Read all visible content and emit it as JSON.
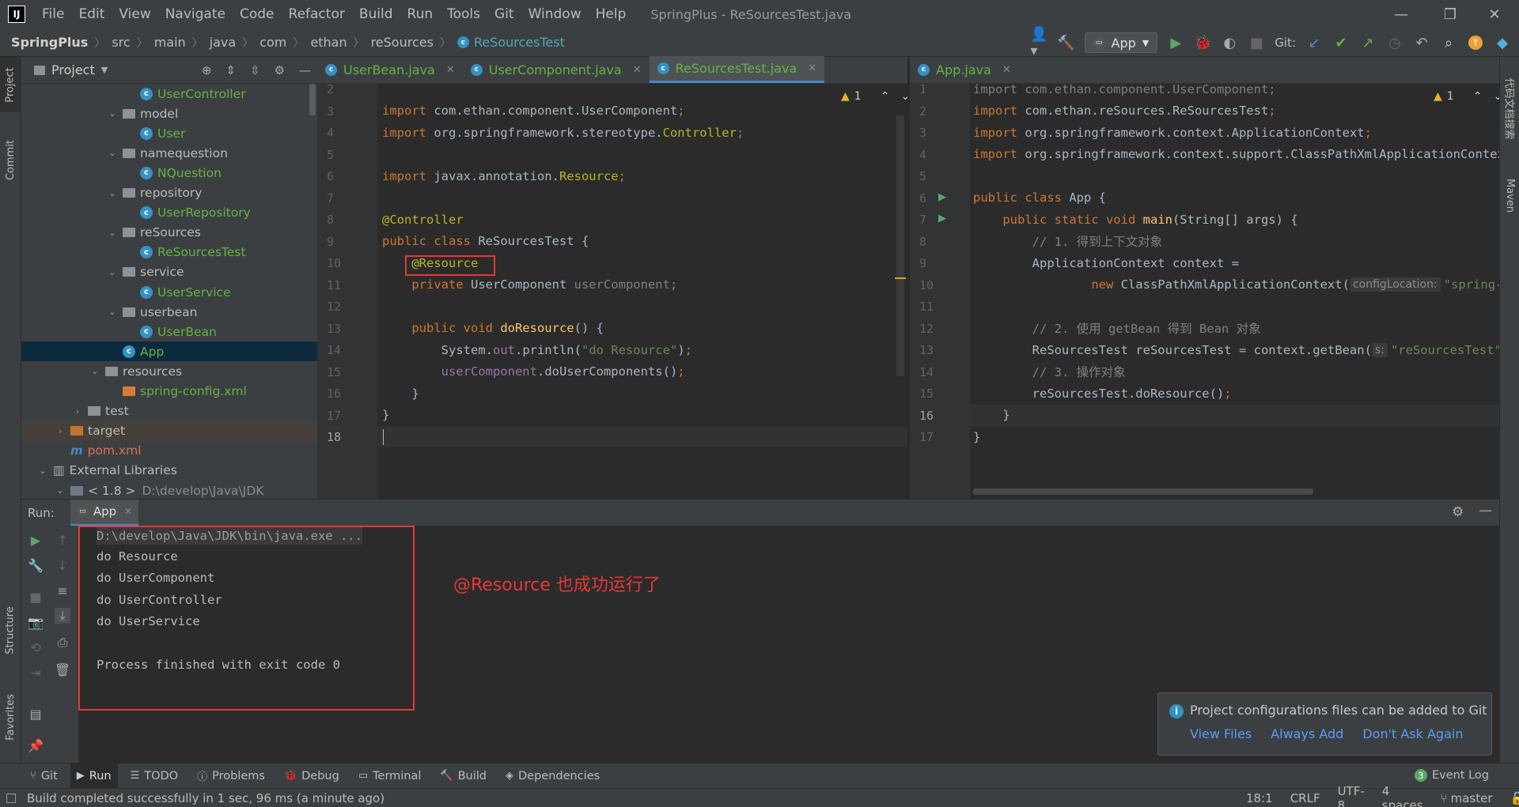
{
  "app": {
    "logo_text": "IJ",
    "menu": [
      "File",
      "Edit",
      "View",
      "Navigate",
      "Code",
      "Refactor",
      "Build",
      "Run",
      "Tools",
      "Git",
      "Window",
      "Help"
    ],
    "window_title": "SpringPlus - ReSourcesTest.java"
  },
  "breadcrumb": [
    "SpringPlus",
    "src",
    "main",
    "java",
    "com",
    "ethan",
    "reSources",
    "ReSourcesTest"
  ],
  "toolbar": {
    "run_config": "App",
    "git_label": "Git:"
  },
  "project_panel": {
    "title": "Project",
    "tree": [
      {
        "label": "UserController",
        "kind": "class",
        "indent": 5
      },
      {
        "label": "model",
        "kind": "folder",
        "indent": 4,
        "expanded": true
      },
      {
        "label": "User",
        "kind": "class",
        "indent": 5
      },
      {
        "label": "namequestion",
        "kind": "folder",
        "indent": 4,
        "expanded": true
      },
      {
        "label": "NQuestion",
        "kind": "class",
        "indent": 5
      },
      {
        "label": "repository",
        "kind": "folder",
        "indent": 4,
        "expanded": true
      },
      {
        "label": "UserRepository",
        "kind": "class",
        "indent": 5
      },
      {
        "label": "reSources",
        "kind": "folder",
        "indent": 4,
        "expanded": true
      },
      {
        "label": "ReSourcesTest",
        "kind": "class",
        "indent": 5
      },
      {
        "label": "service",
        "kind": "folder",
        "indent": 4,
        "expanded": true
      },
      {
        "label": "UserService",
        "kind": "class",
        "indent": 5
      },
      {
        "label": "userbean",
        "kind": "folder",
        "indent": 4,
        "expanded": true
      },
      {
        "label": "UserBean",
        "kind": "class",
        "indent": 5
      },
      {
        "label": "App",
        "kind": "class",
        "indent": 4,
        "selected": true
      },
      {
        "label": "resources",
        "kind": "folder",
        "indent": 3,
        "expanded": true
      },
      {
        "label": "spring-config.xml",
        "kind": "xml",
        "indent": 4
      },
      {
        "label": "test",
        "kind": "folder",
        "indent": 2,
        "expanded": false
      },
      {
        "label": "target",
        "kind": "folder-orange",
        "indent": 1,
        "expanded": false,
        "excluded": true
      },
      {
        "label": "pom.xml",
        "kind": "maven",
        "indent": 1
      },
      {
        "label": "External Libraries",
        "kind": "lib",
        "indent": 0,
        "expanded": true
      },
      {
        "label": "< 1.8 >",
        "extra": "D:\\develop\\Java\\JDK",
        "kind": "jdk",
        "indent": 1,
        "expanded": true
      }
    ]
  },
  "left_editor": {
    "tabs": [
      {
        "label": "UserBean.java",
        "active": false
      },
      {
        "label": "UserComponent.java",
        "active": false
      },
      {
        "label": "ReSourcesTest.java",
        "active": true
      }
    ],
    "warning_count": "1",
    "line_numbers": [
      "2",
      "3",
      "4",
      "5",
      "6",
      "7",
      "8",
      "9",
      "10",
      "11",
      "12",
      "13",
      "14",
      "15",
      "16",
      "17",
      "18"
    ],
    "lines": [
      [],
      [
        [
          "kw",
          "import "
        ],
        [
          "txt",
          "com.ethan.component.UserComponent"
        ],
        [
          "kw",
          ";"
        ]
      ],
      [
        [
          "kw",
          "import "
        ],
        [
          "txt",
          "org.springframework.stereotype."
        ],
        [
          "ann",
          "Controller"
        ],
        [
          "kw",
          ";"
        ]
      ],
      [],
      [
        [
          "kw",
          "import "
        ],
        [
          "txt",
          "javax.annotation."
        ],
        [
          "ann",
          "Resource"
        ],
        [
          "kw",
          ";"
        ]
      ],
      [],
      [
        [
          "ann",
          "@Controller"
        ]
      ],
      [
        [
          "kw",
          "public class "
        ],
        [
          "txt",
          "ReSourcesTest {"
        ]
      ],
      [
        [
          "txt",
          "    "
        ],
        [
          "ann",
          "@Resource"
        ]
      ],
      [
        [
          "txt",
          "    "
        ],
        [
          "kw",
          "private "
        ],
        [
          "txt",
          "UserComponent "
        ],
        [
          "cmt",
          "userComponent"
        ],
        [
          "kw",
          ";"
        ]
      ],
      [],
      [
        [
          "txt",
          "    "
        ],
        [
          "kw",
          "public void "
        ],
        [
          "fn",
          "doResource"
        ],
        [
          "txt",
          "() {"
        ]
      ],
      [
        [
          "txt",
          "        System."
        ],
        [
          "fld",
          "out"
        ],
        [
          "txt",
          ".println("
        ],
        [
          "str",
          "\"do Resource\""
        ],
        [
          "txt",
          ")"
        ],
        [
          "kw",
          ";"
        ]
      ],
      [
        [
          "txt",
          "        "
        ],
        [
          "fld",
          "userComponent"
        ],
        [
          "txt",
          ".doUserComponents()"
        ],
        [
          "kw",
          ";"
        ]
      ],
      [
        [
          "txt",
          "    }"
        ]
      ],
      [
        [
          "txt",
          "}"
        ]
      ],
      []
    ]
  },
  "right_editor": {
    "tabs": [
      {
        "label": "App.java",
        "active": false
      }
    ],
    "warning_count": "1",
    "line_numbers": [
      "1",
      "2",
      "3",
      "4",
      "5",
      "6",
      "7",
      "8",
      "9",
      "10",
      "11",
      "12",
      "13",
      "14",
      "15",
      "16",
      "17"
    ],
    "lines": [
      [
        [
          "grayimp",
          "import com.ethan.component.UserComponent;"
        ]
      ],
      [
        [
          "kw",
          "import "
        ],
        [
          "txt",
          "com.ethan.reSources.ReSourcesTest"
        ],
        [
          "kw",
          ";"
        ]
      ],
      [
        [
          "kw",
          "import "
        ],
        [
          "txt",
          "org.springframework.context.ApplicationContext"
        ],
        [
          "kw",
          ";"
        ]
      ],
      [
        [
          "kw",
          "import "
        ],
        [
          "txt",
          "org.springframework.context.support.ClassPathXmlApplicationContext"
        ],
        [
          "kw",
          ";"
        ]
      ],
      [],
      [
        [
          "kw",
          "public class "
        ],
        [
          "txt",
          "App {"
        ]
      ],
      [
        [
          "txt",
          "    "
        ],
        [
          "kw",
          "public static void "
        ],
        [
          "fn",
          "main"
        ],
        [
          "txt",
          "(String[] args) {"
        ]
      ],
      [
        [
          "txt",
          "        "
        ],
        [
          "cmt",
          "// 1. 得到上下文对象"
        ]
      ],
      [
        [
          "txt",
          "        ApplicationContext context ="
        ]
      ],
      [
        [
          "txt",
          "                "
        ],
        [
          "kw",
          "new "
        ],
        [
          "txt",
          "ClassPathXmlApplicationContext("
        ],
        [
          "hint",
          "configLocation:"
        ],
        [
          "str",
          "\"spring-config.xml\""
        ],
        [
          "txt",
          ")"
        ],
        [
          "kw",
          ";"
        ]
      ],
      [],
      [
        [
          "txt",
          "        "
        ],
        [
          "cmt",
          "// 2. 使用 getBean 得到 Bean 对象"
        ]
      ],
      [
        [
          "txt",
          "        ReSourcesTest reSourcesTest = context.getBean("
        ],
        [
          "hint",
          "s:"
        ],
        [
          "str",
          "\"reSourcesTest\""
        ],
        [
          "txt",
          ")"
        ],
        [
          "kw",
          ";"
        ]
      ],
      [
        [
          "txt",
          "        "
        ],
        [
          "cmt",
          "// 3. 操作对象"
        ]
      ],
      [
        [
          "txt",
          "        reSourcesTest.doResource()"
        ],
        [
          "kw",
          ";"
        ]
      ],
      [
        [
          "txt",
          "    }"
        ]
      ],
      [
        [
          "txt",
          "}"
        ]
      ]
    ]
  },
  "run_panel": {
    "label": "Run:",
    "tab": "App",
    "console": [
      "D:\\develop\\Java\\JDK\\bin\\java.exe ...",
      "do Resource",
      "do UserComponent",
      "do UserController",
      "do UserService",
      "",
      "Process finished with exit code 0"
    ],
    "annotation": "@Resource 也成功运行了"
  },
  "notification": {
    "message": "Project configurations files can be added to Git",
    "actions": [
      "View Files",
      "Always Add",
      "Don't Ask Again"
    ]
  },
  "bottom_tools": [
    {
      "label": "Git",
      "icon": "git-icon"
    },
    {
      "label": "Run",
      "icon": "run-icon",
      "active": true
    },
    {
      "label": "TODO",
      "icon": "todo-icon"
    },
    {
      "label": "Problems",
      "icon": "problems-icon"
    },
    {
      "label": "Debug",
      "icon": "debug-icon"
    },
    {
      "label": "Terminal",
      "icon": "terminal-icon"
    },
    {
      "label": "Build",
      "icon": "build-icon"
    },
    {
      "label": "Dependencies",
      "icon": "dependencies-icon"
    }
  ],
  "event_log": {
    "badge": "3",
    "label": "Event Log"
  },
  "status_bar": {
    "message": "Build completed successfully in 1 sec, 96 ms (a minute ago)",
    "position": "18:1",
    "line_sep": "CRLF",
    "encoding": "UTF-8",
    "indent": "4 spaces",
    "branch": "master"
  },
  "side_tabs": {
    "left": [
      "Project",
      "Commit",
      "Structure",
      "Favorites"
    ],
    "right": [
      "代码文档搜索",
      "Maven"
    ]
  },
  "colors": {
    "background": "#2b2b2b",
    "panel": "#3c3f41",
    "keyword": "#cc7832",
    "annotation": "#bbb529",
    "string": "#6a8759",
    "class_green": "#62b543",
    "highlight_box": "#e53935",
    "link": "#589df6"
  }
}
